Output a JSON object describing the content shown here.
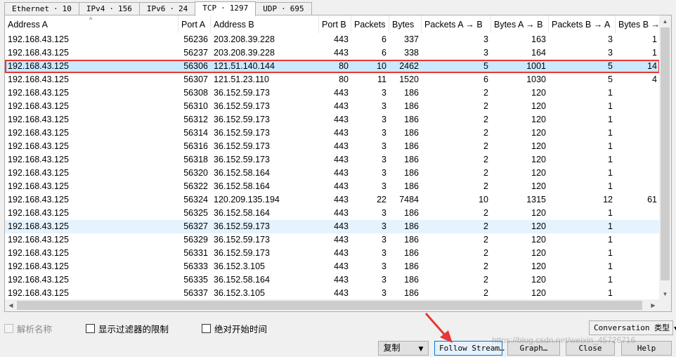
{
  "tabs": [
    {
      "name": "Ethernet",
      "count": "10"
    },
    {
      "name": "IPv4",
      "count": "156"
    },
    {
      "name": "IPv6",
      "count": "24"
    },
    {
      "name": "TCP",
      "count": "1297",
      "active": true
    },
    {
      "name": "UDP",
      "count": "695"
    }
  ],
  "table": {
    "columns": [
      "Address A",
      "Port A",
      "Address B",
      "Port B",
      "Packets",
      "Bytes",
      "Packets A → B",
      "Bytes A → B",
      "Packets B → A",
      "Bytes B →"
    ],
    "selected_index": 2,
    "hover_index": 14,
    "rows": [
      [
        "192.168.43.125",
        "56236",
        "203.208.39.228",
        "443",
        "6",
        "337",
        "3",
        "163",
        "3",
        "1"
      ],
      [
        "192.168.43.125",
        "56237",
        "203.208.39.228",
        "443",
        "6",
        "338",
        "3",
        "164",
        "3",
        "1"
      ],
      [
        "192.168.43.125",
        "56306",
        "121.51.140.144",
        "80",
        "10",
        "2462",
        "5",
        "1001",
        "5",
        "14"
      ],
      [
        "192.168.43.125",
        "56307",
        "121.51.23.110",
        "80",
        "11",
        "1520",
        "6",
        "1030",
        "5",
        "4"
      ],
      [
        "192.168.43.125",
        "56308",
        "36.152.59.173",
        "443",
        "3",
        "186",
        "2",
        "120",
        "1",
        ""
      ],
      [
        "192.168.43.125",
        "56310",
        "36.152.59.173",
        "443",
        "3",
        "186",
        "2",
        "120",
        "1",
        ""
      ],
      [
        "192.168.43.125",
        "56312",
        "36.152.59.173",
        "443",
        "3",
        "186",
        "2",
        "120",
        "1",
        ""
      ],
      [
        "192.168.43.125",
        "56314",
        "36.152.59.173",
        "443",
        "3",
        "186",
        "2",
        "120",
        "1",
        ""
      ],
      [
        "192.168.43.125",
        "56316",
        "36.152.59.173",
        "443",
        "3",
        "186",
        "2",
        "120",
        "1",
        ""
      ],
      [
        "192.168.43.125",
        "56318",
        "36.152.59.173",
        "443",
        "3",
        "186",
        "2",
        "120",
        "1",
        ""
      ],
      [
        "192.168.43.125",
        "56320",
        "36.152.58.164",
        "443",
        "3",
        "186",
        "2",
        "120",
        "1",
        ""
      ],
      [
        "192.168.43.125",
        "56322",
        "36.152.58.164",
        "443",
        "3",
        "186",
        "2",
        "120",
        "1",
        ""
      ],
      [
        "192.168.43.125",
        "56324",
        "120.209.135.194",
        "443",
        "22",
        "7484",
        "10",
        "1315",
        "12",
        "61"
      ],
      [
        "192.168.43.125",
        "56325",
        "36.152.58.164",
        "443",
        "3",
        "186",
        "2",
        "120",
        "1",
        ""
      ],
      [
        "192.168.43.125",
        "56327",
        "36.152.59.173",
        "443",
        "3",
        "186",
        "2",
        "120",
        "1",
        ""
      ],
      [
        "192.168.43.125",
        "56329",
        "36.152.59.173",
        "443",
        "3",
        "186",
        "2",
        "120",
        "1",
        ""
      ],
      [
        "192.168.43.125",
        "56331",
        "36.152.59.173",
        "443",
        "3",
        "186",
        "2",
        "120",
        "1",
        ""
      ],
      [
        "192.168.43.125",
        "56333",
        "36.152.3.105",
        "443",
        "3",
        "186",
        "2",
        "120",
        "1",
        ""
      ],
      [
        "192.168.43.125",
        "56335",
        "36.152.58.164",
        "443",
        "3",
        "186",
        "2",
        "120",
        "1",
        ""
      ],
      [
        "192.168.43.125",
        "56337",
        "36.152.3.105",
        "443",
        "3",
        "186",
        "2",
        "120",
        "1",
        ""
      ]
    ]
  },
  "options": {
    "resolve_names": "解析名称",
    "limit_display_filter": "显示过滤器的限制",
    "absolute_start_time": "绝对开始时间"
  },
  "buttons": {
    "conversation_type": "Conversation 类型",
    "copy": "复制",
    "follow_stream": "Follow Stream…",
    "graph": "Graph…",
    "close": "Close",
    "help": "Help"
  },
  "watermark": "https://blog.csdn.net/weixin_45726716",
  "colors": {
    "selected_row": "#cce8ff",
    "highlight_box": "#e53935",
    "hover_row": "#e5f3ff"
  }
}
